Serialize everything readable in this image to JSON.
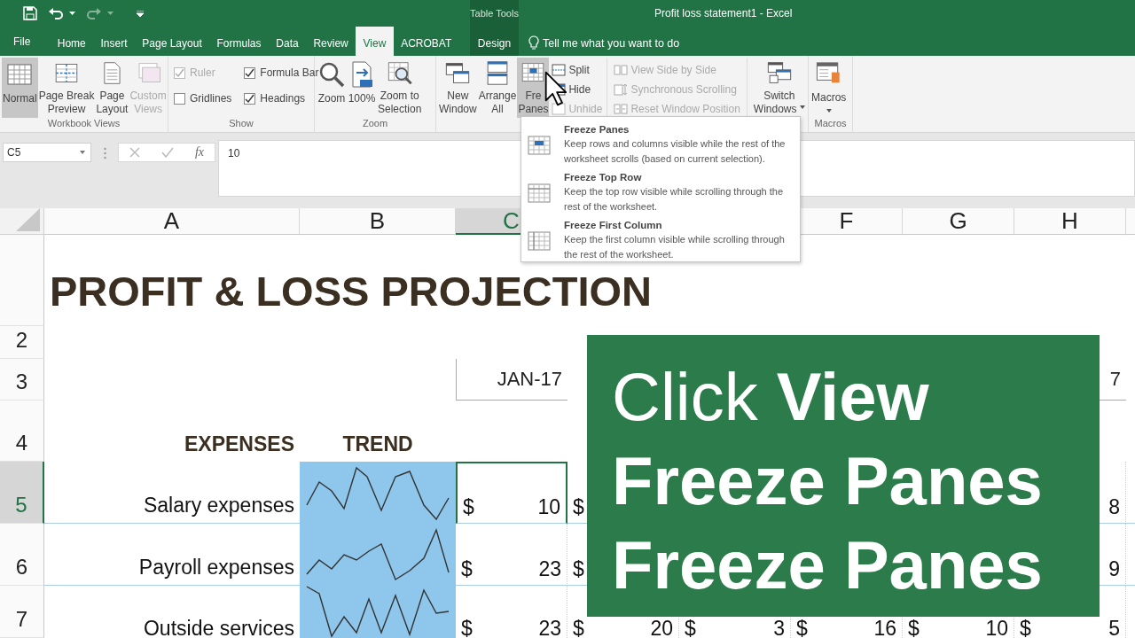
{
  "title_bar": {
    "context_label": "Table Tools",
    "title": "Profit loss statement1  -  Excel"
  },
  "tabs": [
    {
      "label": "File",
      "kind": "file",
      "selected": false
    },
    {
      "label": "Home",
      "kind": "normal",
      "selected": false
    },
    {
      "label": "Insert",
      "kind": "normal",
      "selected": false
    },
    {
      "label": "Page Layout",
      "kind": "normal",
      "selected": false
    },
    {
      "label": "Formulas",
      "kind": "normal",
      "selected": false
    },
    {
      "label": "Data",
      "kind": "normal",
      "selected": false
    },
    {
      "label": "Review",
      "kind": "normal",
      "selected": false
    },
    {
      "label": "View",
      "kind": "normal",
      "selected": true
    },
    {
      "label": "ACROBAT",
      "kind": "normal",
      "selected": false
    },
    {
      "label": "Design",
      "kind": "contextual",
      "selected": false
    }
  ],
  "tell_me": {
    "placeholder": "Tell me what you want to do"
  },
  "ribbon": {
    "workbook_views": {
      "label": "Workbook Views",
      "buttons": [
        {
          "lines": [
            "Normal"
          ],
          "selected": true,
          "disabled": false
        },
        {
          "lines": [
            "Page Break",
            "Preview"
          ],
          "selected": false,
          "disabled": false
        },
        {
          "lines": [
            "Page",
            "Layout"
          ],
          "selected": false,
          "disabled": false
        },
        {
          "lines": [
            "Custom",
            "Views"
          ],
          "selected": false,
          "disabled": true
        }
      ]
    },
    "show": {
      "label": "Show",
      "options": [
        {
          "label": "Ruler",
          "checked": true,
          "disabled": true
        },
        {
          "label": "Gridlines",
          "checked": false,
          "disabled": false
        },
        {
          "label": "Formula Bar",
          "checked": true,
          "disabled": false
        },
        {
          "label": "Headings",
          "checked": true,
          "disabled": false
        }
      ]
    },
    "zoom": {
      "label": "Zoom",
      "buttons": [
        {
          "lines": [
            "Zoom"
          ]
        },
        {
          "lines": [
            "100%"
          ]
        },
        {
          "lines": [
            "Zoom to",
            "Selection"
          ]
        }
      ]
    },
    "window": {
      "buttons": [
        {
          "lines": [
            "New",
            "Window"
          ],
          "pressed": false
        },
        {
          "lines": [
            "Arrange",
            "All"
          ],
          "pressed": false
        },
        {
          "lines": [
            "Fre",
            "Panes"
          ],
          "pressed": true
        }
      ],
      "small_buttons": [
        {
          "label": "Split",
          "disabled": false
        },
        {
          "label": "Hide",
          "disabled": false
        },
        {
          "label": "Unhide",
          "disabled": true
        },
        {
          "label": "View Side by Side",
          "disabled": true
        },
        {
          "label": "Synchronous Scrolling",
          "disabled": true
        },
        {
          "label": "Reset Window Position",
          "disabled": true
        }
      ],
      "switch_button": {
        "lines": [
          "Switch",
          "Windows"
        ]
      }
    },
    "macros": {
      "label": "Macros",
      "button": {
        "lines": [
          "Macros"
        ]
      }
    }
  },
  "formula_bar": {
    "name_box": "C5",
    "function_label": "fx",
    "value": "10"
  },
  "freeze_menu": [
    {
      "title": "Freeze Panes",
      "description": "Keep rows and columns visible while the rest of the worksheet scrolls (based on current selection)."
    },
    {
      "title": "Freeze Top Row",
      "description": "Keep the top row visible while scrolling through the rest of the worksheet."
    },
    {
      "title": "Freeze First Column",
      "description": "Keep the first column visible while scrolling through the rest of the worksheet."
    }
  ],
  "columns": [
    {
      "label": "A",
      "selected": false
    },
    {
      "label": "B",
      "selected": false
    },
    {
      "label": "C",
      "selected": true
    },
    null,
    null,
    {
      "label": "F",
      "selected": false
    },
    {
      "label": "G",
      "selected": false
    },
    {
      "label": "H",
      "selected": false
    }
  ],
  "rows": [
    {
      "selected": false,
      "cells": [
        {
          "kind": "title",
          "text": "PROFIT & LOSS PROJECTION"
        },
        null,
        null,
        null,
        null,
        null,
        null,
        null
      ]
    },
    {
      "header": "2",
      "selected": false,
      "cells": [
        null,
        null,
        null,
        null,
        null,
        null,
        null,
        null
      ]
    },
    {
      "header": "3",
      "selected": false,
      "cells": [
        null,
        null,
        {
          "kind": "month",
          "text": "JAN-17"
        },
        null,
        null,
        null,
        null,
        {
          "kind": "month",
          "text": "7"
        }
      ]
    },
    {
      "header": "4",
      "selected": false,
      "cells": [
        {
          "kind": "heading",
          "text": "EXPENSES"
        },
        {
          "kind": "heading",
          "text": "TREND"
        },
        null,
        null,
        null,
        null,
        null,
        null
      ]
    },
    {
      "header": "5",
      "selected": true,
      "cells": [
        {
          "kind": "label",
          "text": "Salary expenses"
        },
        {
          "kind": "sparkline"
        },
        {
          "kind": "money",
          "currency": "$",
          "amount": "10",
          "selected": true
        },
        {
          "kind": "money",
          "currency": "$",
          "selected": false
        },
        null,
        null,
        null,
        {
          "kind": "money",
          "amount": "8",
          "selected": false
        }
      ]
    },
    {
      "header": "6",
      "selected": false,
      "cells": [
        {
          "kind": "label",
          "text": "Payroll expenses"
        },
        {
          "kind": "sparkline"
        },
        {
          "kind": "money",
          "currency": "$",
          "amount": "23",
          "selected": false
        },
        {
          "kind": "money",
          "currency": "$",
          "selected": false
        },
        null,
        null,
        null,
        {
          "kind": "money",
          "amount": "9",
          "selected": false
        }
      ]
    },
    {
      "header": "7",
      "selected": false,
      "cells": [
        {
          "kind": "label",
          "text": "Outside services"
        },
        {
          "kind": "sparkline"
        },
        {
          "kind": "money",
          "currency": "$",
          "amount": "23",
          "selected": false
        },
        {
          "kind": "money",
          "currency": "$",
          "amount": "20",
          "selected": false
        },
        {
          "kind": "money",
          "currency": "$",
          "amount": "3",
          "selected": false
        },
        {
          "kind": "money",
          "currency": "$",
          "amount": "16",
          "selected": false
        },
        {
          "kind": "money",
          "currency": "$",
          "amount": "10",
          "selected": false
        },
        {
          "kind": "money",
          "currency": "$",
          "amount": "5",
          "selected": false
        }
      ]
    }
  ],
  "caption": [
    "Click **View**",
    "Freeze Panes",
    "Freeze Panes"
  ]
}
